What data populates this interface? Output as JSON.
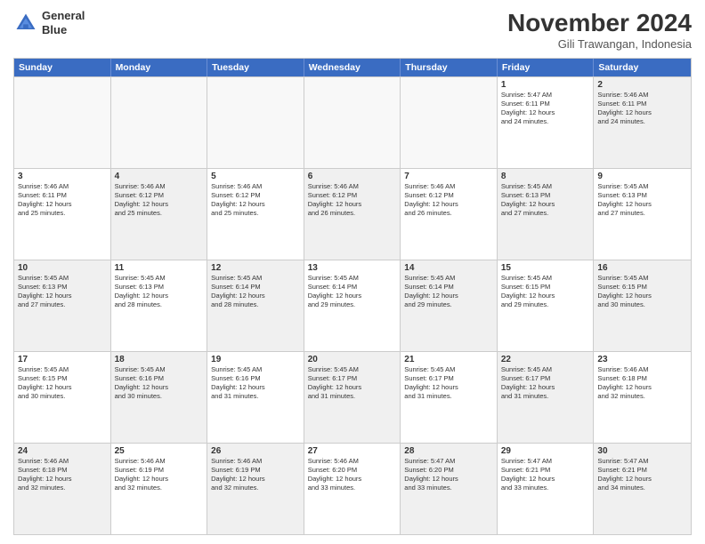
{
  "header": {
    "logo_line1": "General",
    "logo_line2": "Blue",
    "month": "November 2024",
    "location": "Gili Trawangan, Indonesia"
  },
  "days": [
    "Sunday",
    "Monday",
    "Tuesday",
    "Wednesday",
    "Thursday",
    "Friday",
    "Saturday"
  ],
  "rows": [
    [
      {
        "day": "",
        "text": "",
        "empty": true
      },
      {
        "day": "",
        "text": "",
        "empty": true
      },
      {
        "day": "",
        "text": "",
        "empty": true
      },
      {
        "day": "",
        "text": "",
        "empty": true
      },
      {
        "day": "",
        "text": "",
        "empty": true
      },
      {
        "day": "1",
        "text": "Sunrise: 5:47 AM\nSunset: 6:11 PM\nDaylight: 12 hours\nand 24 minutes.",
        "empty": false
      },
      {
        "day": "2",
        "text": "Sunrise: 5:46 AM\nSunset: 6:11 PM\nDaylight: 12 hours\nand 24 minutes.",
        "empty": false,
        "shaded": true
      }
    ],
    [
      {
        "day": "3",
        "text": "Sunrise: 5:46 AM\nSunset: 6:11 PM\nDaylight: 12 hours\nand 25 minutes.",
        "empty": false
      },
      {
        "day": "4",
        "text": "Sunrise: 5:46 AM\nSunset: 6:12 PM\nDaylight: 12 hours\nand 25 minutes.",
        "empty": false,
        "shaded": true
      },
      {
        "day": "5",
        "text": "Sunrise: 5:46 AM\nSunset: 6:12 PM\nDaylight: 12 hours\nand 25 minutes.",
        "empty": false
      },
      {
        "day": "6",
        "text": "Sunrise: 5:46 AM\nSunset: 6:12 PM\nDaylight: 12 hours\nand 26 minutes.",
        "empty": false,
        "shaded": true
      },
      {
        "day": "7",
        "text": "Sunrise: 5:46 AM\nSunset: 6:12 PM\nDaylight: 12 hours\nand 26 minutes.",
        "empty": false
      },
      {
        "day": "8",
        "text": "Sunrise: 5:45 AM\nSunset: 6:13 PM\nDaylight: 12 hours\nand 27 minutes.",
        "empty": false,
        "shaded": true
      },
      {
        "day": "9",
        "text": "Sunrise: 5:45 AM\nSunset: 6:13 PM\nDaylight: 12 hours\nand 27 minutes.",
        "empty": false
      }
    ],
    [
      {
        "day": "10",
        "text": "Sunrise: 5:45 AM\nSunset: 6:13 PM\nDaylight: 12 hours\nand 27 minutes.",
        "empty": false,
        "shaded": true
      },
      {
        "day": "11",
        "text": "Sunrise: 5:45 AM\nSunset: 6:13 PM\nDaylight: 12 hours\nand 28 minutes.",
        "empty": false
      },
      {
        "day": "12",
        "text": "Sunrise: 5:45 AM\nSunset: 6:14 PM\nDaylight: 12 hours\nand 28 minutes.",
        "empty": false,
        "shaded": true
      },
      {
        "day": "13",
        "text": "Sunrise: 5:45 AM\nSunset: 6:14 PM\nDaylight: 12 hours\nand 29 minutes.",
        "empty": false
      },
      {
        "day": "14",
        "text": "Sunrise: 5:45 AM\nSunset: 6:14 PM\nDaylight: 12 hours\nand 29 minutes.",
        "empty": false,
        "shaded": true
      },
      {
        "day": "15",
        "text": "Sunrise: 5:45 AM\nSunset: 6:15 PM\nDaylight: 12 hours\nand 29 minutes.",
        "empty": false
      },
      {
        "day": "16",
        "text": "Sunrise: 5:45 AM\nSunset: 6:15 PM\nDaylight: 12 hours\nand 30 minutes.",
        "empty": false,
        "shaded": true
      }
    ],
    [
      {
        "day": "17",
        "text": "Sunrise: 5:45 AM\nSunset: 6:15 PM\nDaylight: 12 hours\nand 30 minutes.",
        "empty": false
      },
      {
        "day": "18",
        "text": "Sunrise: 5:45 AM\nSunset: 6:16 PM\nDaylight: 12 hours\nand 30 minutes.",
        "empty": false,
        "shaded": true
      },
      {
        "day": "19",
        "text": "Sunrise: 5:45 AM\nSunset: 6:16 PM\nDaylight: 12 hours\nand 31 minutes.",
        "empty": false
      },
      {
        "day": "20",
        "text": "Sunrise: 5:45 AM\nSunset: 6:17 PM\nDaylight: 12 hours\nand 31 minutes.",
        "empty": false,
        "shaded": true
      },
      {
        "day": "21",
        "text": "Sunrise: 5:45 AM\nSunset: 6:17 PM\nDaylight: 12 hours\nand 31 minutes.",
        "empty": false
      },
      {
        "day": "22",
        "text": "Sunrise: 5:45 AM\nSunset: 6:17 PM\nDaylight: 12 hours\nand 31 minutes.",
        "empty": false,
        "shaded": true
      },
      {
        "day": "23",
        "text": "Sunrise: 5:46 AM\nSunset: 6:18 PM\nDaylight: 12 hours\nand 32 minutes.",
        "empty": false
      }
    ],
    [
      {
        "day": "24",
        "text": "Sunrise: 5:46 AM\nSunset: 6:18 PM\nDaylight: 12 hours\nand 32 minutes.",
        "empty": false,
        "shaded": true
      },
      {
        "day": "25",
        "text": "Sunrise: 5:46 AM\nSunset: 6:19 PM\nDaylight: 12 hours\nand 32 minutes.",
        "empty": false
      },
      {
        "day": "26",
        "text": "Sunrise: 5:46 AM\nSunset: 6:19 PM\nDaylight: 12 hours\nand 32 minutes.",
        "empty": false,
        "shaded": true
      },
      {
        "day": "27",
        "text": "Sunrise: 5:46 AM\nSunset: 6:20 PM\nDaylight: 12 hours\nand 33 minutes.",
        "empty": false
      },
      {
        "day": "28",
        "text": "Sunrise: 5:47 AM\nSunset: 6:20 PM\nDaylight: 12 hours\nand 33 minutes.",
        "empty": false,
        "shaded": true
      },
      {
        "day": "29",
        "text": "Sunrise: 5:47 AM\nSunset: 6:21 PM\nDaylight: 12 hours\nand 33 minutes.",
        "empty": false
      },
      {
        "day": "30",
        "text": "Sunrise: 5:47 AM\nSunset: 6:21 PM\nDaylight: 12 hours\nand 34 minutes.",
        "empty": false,
        "shaded": true
      }
    ]
  ]
}
